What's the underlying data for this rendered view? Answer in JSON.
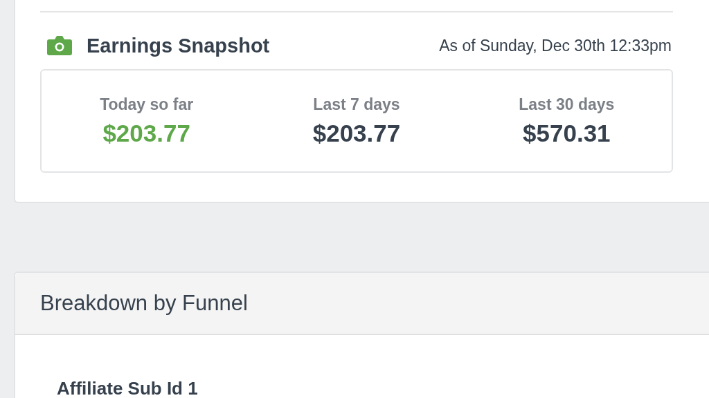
{
  "snapshot": {
    "title": "Earnings Snapshot",
    "as_of": "As of Sunday, Dec 30th 12:33pm",
    "stats": [
      {
        "label": "Today so far",
        "value": "$203.77",
        "highlighted": true
      },
      {
        "label": "Last 7 days",
        "value": "$203.77",
        "highlighted": false
      },
      {
        "label": "Last 30 days",
        "value": "$570.31",
        "highlighted": false
      }
    ]
  },
  "breakdown": {
    "title": "Breakdown by Funnel",
    "subheading": "Affiliate Sub Id 1"
  }
}
